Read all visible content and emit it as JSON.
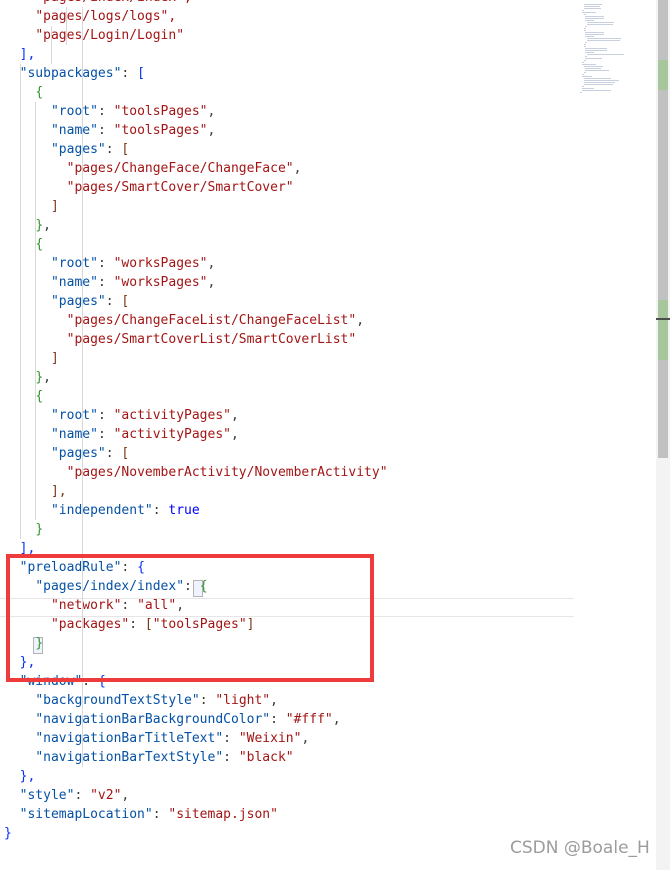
{
  "editor": {
    "lines": [
      [
        "    ",
        [
          "s",
          "\"pages/index/index\","
        ]
      ],
      [
        "    ",
        [
          "s",
          "\"pages/logs/logs\","
        ]
      ],
      [
        "    ",
        [
          "s",
          "\"pages/Login/Login\""
        ]
      ],
      [
        "  ",
        [
          "b1",
          "],"
        ]
      ],
      [
        "  ",
        [
          "k",
          "\"subpackages\""
        ],
        [
          "p",
          ": "
        ],
        [
          "b1",
          "["
        ]
      ],
      [
        "    ",
        [
          "b2",
          "{"
        ]
      ],
      [
        "      ",
        [
          "k",
          "\"root\""
        ],
        [
          "p",
          ": "
        ],
        [
          "s",
          "\"toolsPages\""
        ],
        [
          "p",
          ","
        ]
      ],
      [
        "      ",
        [
          "k",
          "\"name\""
        ],
        [
          "p",
          ": "
        ],
        [
          "s",
          "\"toolsPages\""
        ],
        [
          "p",
          ","
        ]
      ],
      [
        "      ",
        [
          "k",
          "\"pages\""
        ],
        [
          "p",
          ": "
        ],
        [
          "b3",
          "["
        ]
      ],
      [
        "        ",
        [
          "s",
          "\"pages/ChangeFace/ChangeFace\""
        ],
        [
          "p",
          ","
        ]
      ],
      [
        "        ",
        [
          "s",
          "\"pages/SmartCover/SmartCover\""
        ]
      ],
      [
        "      ",
        [
          "b3",
          "]"
        ]
      ],
      [
        "    ",
        [
          "b2",
          "}"
        ],
        [
          "p",
          ","
        ]
      ],
      [
        "    ",
        [
          "b2",
          "{"
        ]
      ],
      [
        "      ",
        [
          "k",
          "\"root\""
        ],
        [
          "p",
          ": "
        ],
        [
          "s",
          "\"worksPages\""
        ],
        [
          "p",
          ","
        ]
      ],
      [
        "      ",
        [
          "k",
          "\"name\""
        ],
        [
          "p",
          ": "
        ],
        [
          "s",
          "\"worksPages\""
        ],
        [
          "p",
          ","
        ]
      ],
      [
        "      ",
        [
          "k",
          "\"pages\""
        ],
        [
          "p",
          ": "
        ],
        [
          "b3",
          "["
        ]
      ],
      [
        "        ",
        [
          "s",
          "\"pages/ChangeFaceList/ChangeFaceList\""
        ],
        [
          "p",
          ","
        ]
      ],
      [
        "        ",
        [
          "s",
          "\"pages/SmartCoverList/SmartCoverList\""
        ]
      ],
      [
        "      ",
        [
          "b3",
          "]"
        ]
      ],
      [
        "    ",
        [
          "b2",
          "}"
        ],
        [
          "p",
          ","
        ]
      ],
      [
        "    ",
        [
          "b2",
          "{"
        ]
      ],
      [
        "      ",
        [
          "k",
          "\"root\""
        ],
        [
          "p",
          ": "
        ],
        [
          "s",
          "\"activityPages\""
        ],
        [
          "p",
          ","
        ]
      ],
      [
        "      ",
        [
          "k",
          "\"name\""
        ],
        [
          "p",
          ": "
        ],
        [
          "s",
          "\"activityPages\""
        ],
        [
          "p",
          ","
        ]
      ],
      [
        "      ",
        [
          "k",
          "\"pages\""
        ],
        [
          "p",
          ": "
        ],
        [
          "b3",
          "["
        ]
      ],
      [
        "        ",
        [
          "s",
          "\"pages/NovemberActivity/NovemberActivity\""
        ]
      ],
      [
        "      ",
        [
          "b3",
          "],"
        ]
      ],
      [
        "      ",
        [
          "k",
          "\"independent\""
        ],
        [
          "p",
          ": "
        ],
        [
          "bool",
          "true"
        ]
      ],
      [
        "    ",
        [
          "b2",
          "}"
        ]
      ],
      [
        "  ",
        [
          "b1",
          "],"
        ]
      ],
      [
        "  ",
        [
          "k",
          "\"preloadRule\""
        ],
        [
          "p",
          ": "
        ],
        [
          "b1",
          "{"
        ]
      ],
      [
        "    ",
        [
          "k",
          "\"pages/index/index\""
        ],
        [
          "p",
          ": "
        ],
        [
          "b2",
          "{"
        ]
      ],
      [
        "      ",
        [
          "s",
          "\"network\""
        ],
        [
          "p",
          ": "
        ],
        [
          "s",
          "\"all\""
        ],
        [
          "p",
          ","
        ]
      ],
      [
        "      ",
        [
          "s",
          "\"packages\""
        ],
        [
          "p",
          ": "
        ],
        [
          "b3",
          "["
        ],
        [
          "s",
          "\"toolsPages\""
        ],
        [
          "b3",
          "]"
        ]
      ],
      [
        "    ",
        [
          "b2",
          "}"
        ]
      ],
      [
        "  ",
        [
          "b1",
          "},"
        ]
      ],
      [
        "  ",
        [
          "k",
          "\"window\""
        ],
        [
          "p",
          ": "
        ],
        [
          "b1",
          "{"
        ]
      ],
      [
        "    ",
        [
          "k",
          "\"backgroundTextStyle\""
        ],
        [
          "p",
          ": "
        ],
        [
          "s",
          "\"light\""
        ],
        [
          "p",
          ","
        ]
      ],
      [
        "    ",
        [
          "k",
          "\"navigationBarBackgroundColor\""
        ],
        [
          "p",
          ": "
        ],
        [
          "s",
          "\"#fff\""
        ],
        [
          "p",
          ","
        ]
      ],
      [
        "    ",
        [
          "k",
          "\"navigationBarTitleText\""
        ],
        [
          "p",
          ": "
        ],
        [
          "s",
          "\"Weixin\""
        ],
        [
          "p",
          ","
        ]
      ],
      [
        "    ",
        [
          "k",
          "\"navigationBarTextStyle\""
        ],
        [
          "p",
          ": "
        ],
        [
          "s",
          "\"black\""
        ]
      ],
      [
        "  ",
        [
          "b1",
          "},"
        ]
      ],
      [
        "  ",
        [
          "k",
          "\"style\""
        ],
        [
          "p",
          ": "
        ],
        [
          "s",
          "\"v2\""
        ],
        [
          "p",
          ","
        ]
      ],
      [
        "  ",
        [
          "k",
          "\"sitemapLocation\""
        ],
        [
          "p",
          ": "
        ],
        [
          "s",
          "\"sitemap.json\""
        ]
      ],
      [
        "",
        [
          "b1",
          "}"
        ]
      ]
    ]
  },
  "colors": {
    "string": "#a31515",
    "key": "#0451a5",
    "boolean": "#0000ff",
    "bracket_level1": "#0431fa",
    "bracket_level2": "#319331",
    "bracket_level3": "#7b3814",
    "highlight": "#ee3b3b"
  },
  "watermark": "CSDN @Boale_H"
}
